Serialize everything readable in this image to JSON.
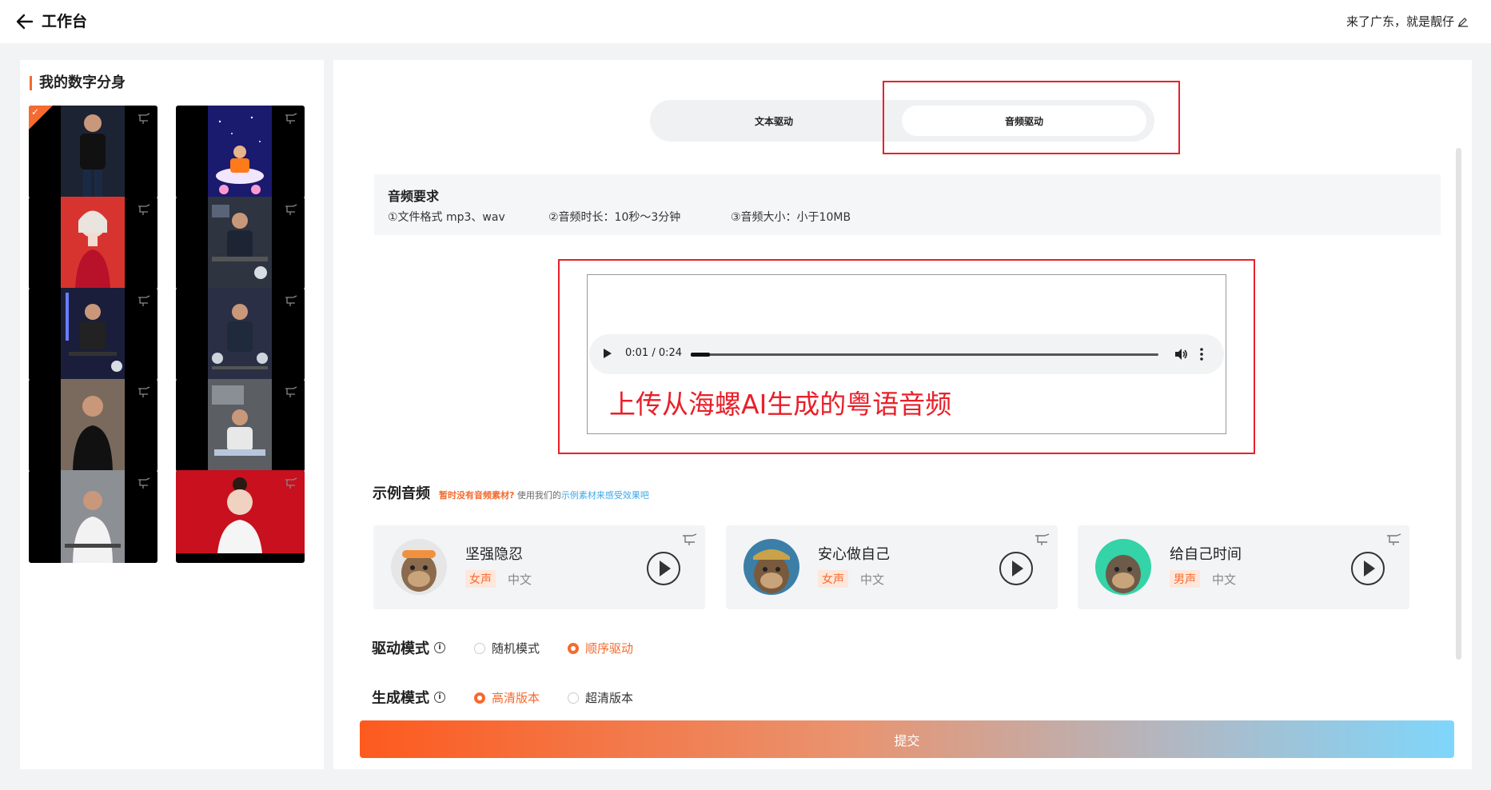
{
  "header": {
    "back_icon": "arrow-left-icon",
    "title": "工作台",
    "user_name": "来了广东，就是靓仔",
    "edit_icon": "edit-pencil-icon"
  },
  "sidebar": {
    "title": "我的数字分身",
    "avatars": [
      {
        "label": "man-black-tshirt-stage",
        "selected": true
      },
      {
        "label": "cartoon-figure-starry-sky",
        "selected": false
      },
      {
        "label": "woman-red-dress",
        "selected": false
      },
      {
        "label": "man-studio-desk",
        "selected": false
      },
      {
        "label": "man-tech-studio-robot",
        "selected": false
      },
      {
        "label": "man-showroom-robot",
        "selected": false
      },
      {
        "label": "man-black-tshirt-room",
        "selected": false
      },
      {
        "label": "man-laptop-office",
        "selected": false
      },
      {
        "label": "man-white-shirt-office",
        "selected": false
      },
      {
        "label": "woman-red-background",
        "selected": false
      }
    ]
  },
  "drive_tabs": {
    "text_label": "文本驱动",
    "audio_label": "音频驱动",
    "active": "audio"
  },
  "requirements": {
    "title": "音频要求",
    "items": [
      "①文件格式 mp3、wav",
      "②音频时长：10秒～3分钟",
      "③音频大小：小于10MB"
    ]
  },
  "player": {
    "time": "0:01 / 0:24",
    "progress": 0.0417
  },
  "annotation": "上传从海螺AI生成的粤语音频",
  "examples": {
    "title": "示例音频",
    "hint_prefix": "暂时没有音频素材?",
    "hint_middle": "使用我们的",
    "hint_link": "示例素材来感受效果吧",
    "items": [
      {
        "name": "坚强隐忍",
        "gender": "女声",
        "lang": "中文",
        "avatar_color": "#e6e6e6"
      },
      {
        "name": "安心做自己",
        "gender": "女声",
        "lang": "中文",
        "avatar_color": "#3b7fa8"
      },
      {
        "name": "给自己时间",
        "gender": "男声",
        "lang": "中文",
        "avatar_color": "#34d3a8"
      }
    ]
  },
  "drive_mode": {
    "label": "驱动模式",
    "options": [
      "随机模式",
      "顺序驱动"
    ],
    "selected": 1
  },
  "gen_mode": {
    "label": "生成模式",
    "options": [
      "高清版本",
      "超清版本"
    ],
    "selected": 0
  },
  "submit_label": "提交",
  "colors": {
    "accent": "#f56a2e",
    "annotation_red": "#e8202a",
    "link_blue": "#3ba7e6"
  }
}
